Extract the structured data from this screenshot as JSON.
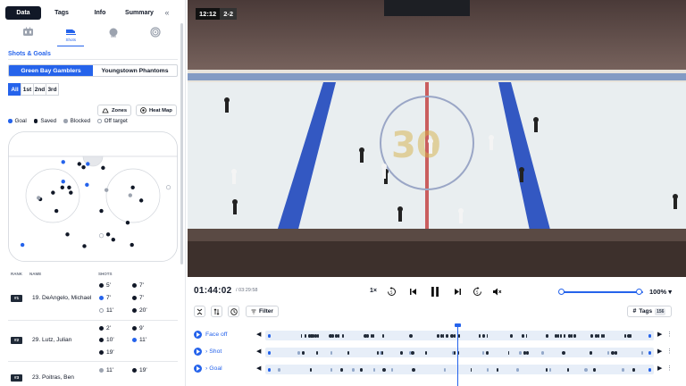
{
  "sidebar": {
    "tabs": [
      {
        "label": "Data",
        "active": true
      },
      {
        "label": "Tags",
        "active": false
      },
      {
        "label": "Info",
        "active": false
      },
      {
        "label": "Summary",
        "active": false
      }
    ],
    "collapse_icon": "double-chevron-left-icon",
    "categories": [
      {
        "icon": "scoreboard-icon",
        "label": ""
      },
      {
        "icon": "skates-icon",
        "label": "Shots",
        "active": true
      },
      {
        "icon": "puck-icon",
        "label": ""
      },
      {
        "icon": "target-icon",
        "label": ""
      }
    ],
    "section_title": "Shots & Goals",
    "teams": [
      {
        "label": "Green Bay Gamblers",
        "active": true
      },
      {
        "label": "Youngstown Phantoms",
        "active": false
      }
    ],
    "periods": [
      {
        "label": "All",
        "active": true
      },
      {
        "label": "1st",
        "active": false
      },
      {
        "label": "2nd",
        "active": false
      },
      {
        "label": "3rd",
        "active": false
      }
    ],
    "zones_label": "Zones",
    "heatmap_label": "Heat Map",
    "legend": [
      {
        "label": "Goal",
        "color": "#2563eb"
      },
      {
        "label": "Saved",
        "color": "#111827"
      },
      {
        "label": "Blocked",
        "color": "#9ca3af"
      },
      {
        "label": "Off target",
        "color": "#ffffff"
      }
    ],
    "leaderboard": {
      "headers": {
        "rank": "RANK",
        "name": "NAME",
        "shots": "SHOTS"
      },
      "players": [
        {
          "rank": "#1",
          "name": "19. DeAngelo, Michael",
          "shots": [
            {
              "t": "5'",
              "k": "saved"
            },
            {
              "t": "7'",
              "k": "saved"
            },
            {
              "t": "7'",
              "k": "goal"
            },
            {
              "t": "7'",
              "k": "saved"
            },
            {
              "t": "11'",
              "k": "off"
            },
            {
              "t": "20'",
              "k": "saved"
            }
          ]
        },
        {
          "rank": "#2",
          "name": "29. Lutz, Julian",
          "shots": [
            {
              "t": "2'",
              "k": "saved"
            },
            {
              "t": "9'",
              "k": "saved"
            },
            {
              "t": "10'",
              "k": "saved"
            },
            {
              "t": "11'",
              "k": "goal"
            },
            {
              "t": "19'",
              "k": "saved"
            }
          ]
        },
        {
          "rank": "#3",
          "name": "23. Poitras, Ben",
          "shots": [
            {
              "t": "11'",
              "k": "blocked"
            },
            {
              "t": "19'",
              "k": "saved"
            }
          ]
        }
      ]
    }
  },
  "shot_map": {
    "goals": [
      [
        0.325,
        0.235
      ],
      [
        0.325,
        0.385
      ],
      [
        0.465,
        0.41
      ],
      [
        0.47,
        0.25
      ],
      [
        0.085,
        0.87
      ]
    ],
    "saved": [
      [
        0.42,
        0.25
      ],
      [
        0.445,
        0.275
      ],
      [
        0.56,
        0.28
      ],
      [
        0.32,
        0.43
      ],
      [
        0.36,
        0.43
      ],
      [
        0.265,
        0.47
      ],
      [
        0.37,
        0.47
      ],
      [
        0.19,
        0.52
      ],
      [
        0.285,
        0.61
      ],
      [
        0.55,
        0.61
      ],
      [
        0.735,
        0.43
      ],
      [
        0.705,
        0.7
      ],
      [
        0.73,
        0.87
      ],
      [
        0.62,
        0.83
      ],
      [
        0.45,
        0.88
      ],
      [
        0.785,
        0.53
      ],
      [
        0.35,
        0.79
      ],
      [
        0.59,
        0.79
      ]
    ],
    "blocked": [
      [
        0.18,
        0.51
      ],
      [
        0.58,
        0.45
      ],
      [
        0.72,
        0.49
      ]
    ],
    "off": [
      [
        0.55,
        0.8
      ],
      [
        0.945,
        0.43
      ]
    ]
  },
  "video": {
    "clock": "12:12",
    "score": "2-2"
  },
  "player": {
    "current_time": "01:44:02",
    "duration": "/ 03:29:58",
    "speed": "1×",
    "zoom": "100%",
    "zoom_fraction": 0.95,
    "filter_label": "Filter",
    "tags_label": "Tags",
    "tags_count": "156"
  },
  "timeline": {
    "tracks": [
      {
        "label": "Face off",
        "expand": false
      },
      {
        "label": "Shot",
        "expand": true
      },
      {
        "label": "Goal",
        "expand": true
      }
    ]
  }
}
